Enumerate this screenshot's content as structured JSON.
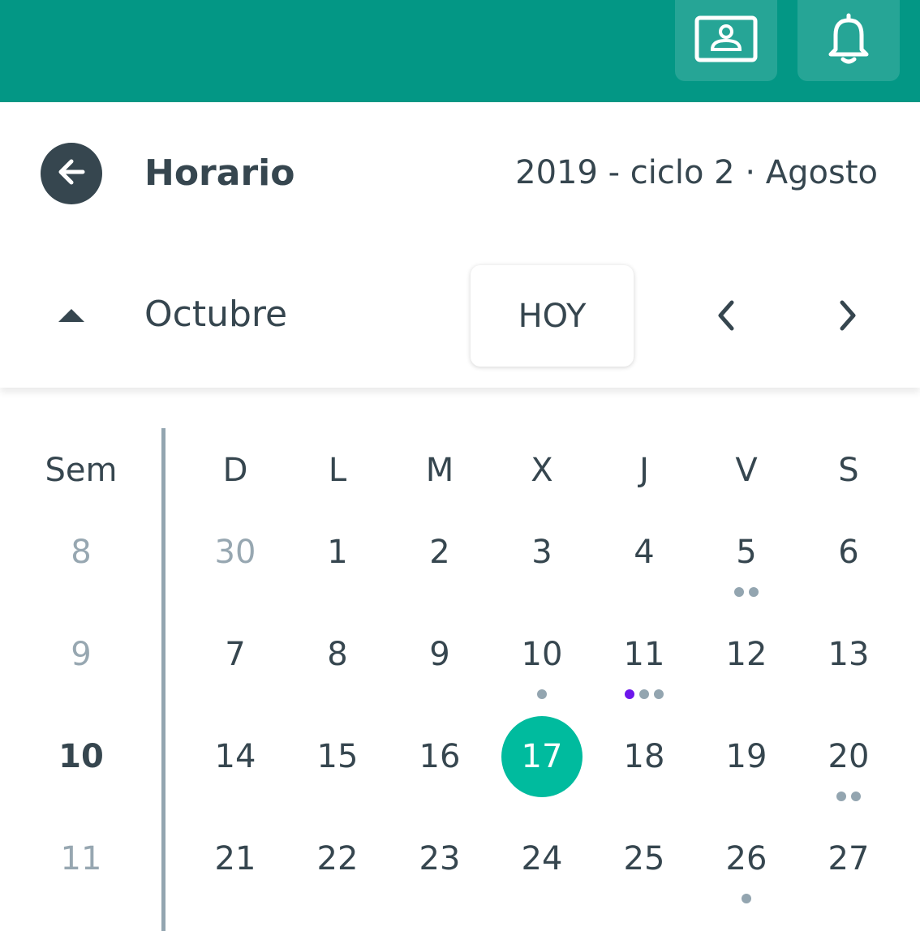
{
  "topbar": {
    "color": "#039785",
    "buttons": [
      {
        "icon": "profile-card-icon"
      },
      {
        "icon": "bell-icon"
      }
    ]
  },
  "header": {
    "title": "Horario",
    "cycle": "2019 - ciclo 2 · Agosto",
    "back_icon": "arrow-left-icon"
  },
  "month_bar": {
    "month": "Octubre",
    "today_button": "HOY",
    "collapse_icon": "triangle-up-icon",
    "prev_icon": "chevron-left-icon",
    "next_icon": "chevron-right-icon"
  },
  "calendar": {
    "week_header": "Sem",
    "day_headers": [
      "D",
      "L",
      "M",
      "X",
      "J",
      "V",
      "S"
    ],
    "today_color": "#00bb9e",
    "event_dot_colors": {
      "gray": "#93a5b0",
      "purple": "#6d16eb"
    },
    "weeks": [
      {
        "week": "8",
        "days": [
          "30",
          "1",
          "2",
          "3",
          "4",
          "5",
          "6"
        ]
      },
      {
        "week": "9",
        "days": [
          "7",
          "8",
          "9",
          "10",
          "11",
          "12",
          "13"
        ]
      },
      {
        "week": "10",
        "days": [
          "14",
          "15",
          "16",
          "17",
          "18",
          "19",
          "20"
        ]
      },
      {
        "week": "11",
        "days": [
          "21",
          "22",
          "23",
          "24",
          "25",
          "26",
          "27"
        ]
      }
    ],
    "current_week": "10",
    "today": "17",
    "outside_month_days": [
      "30"
    ],
    "events": [
      {
        "day": "5",
        "dots": [
          "gray",
          "gray"
        ]
      },
      {
        "day": "10",
        "dots": [
          "gray"
        ]
      },
      {
        "day": "11",
        "dots": [
          "purple",
          "gray",
          "gray"
        ]
      },
      {
        "day": "20",
        "dots": [
          "gray",
          "gray"
        ]
      },
      {
        "day": "26",
        "dots": [
          "gray"
        ]
      }
    ]
  }
}
